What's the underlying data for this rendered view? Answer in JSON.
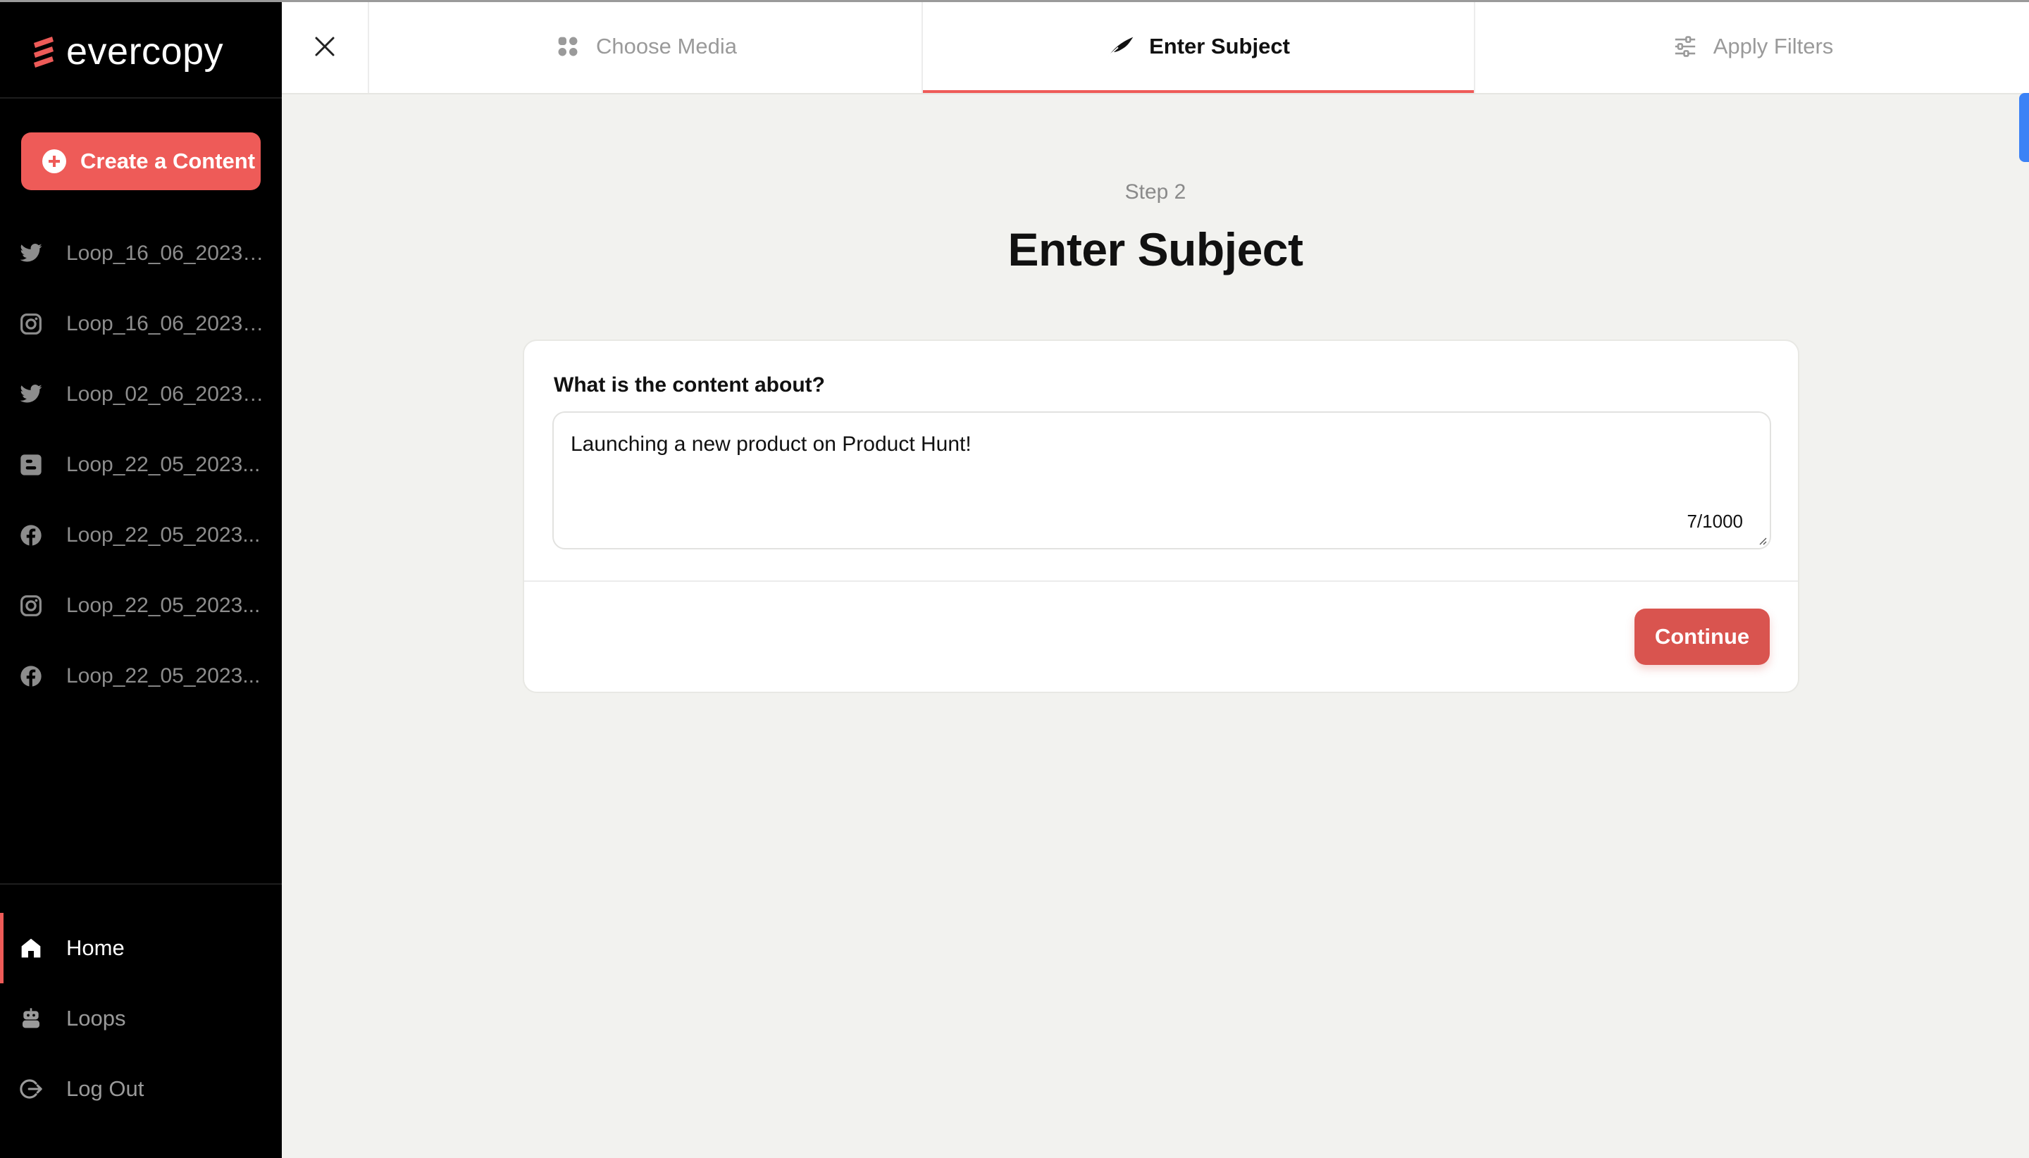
{
  "brand": {
    "name": "evercopy",
    "accent": "#ee5b58"
  },
  "sidebar": {
    "create_button": "Create a Content",
    "loops": [
      {
        "icon": "twitter-icon",
        "label": "Loop_16_06_2023_..."
      },
      {
        "icon": "instagram-icon",
        "label": "Loop_16_06_2023_1..."
      },
      {
        "icon": "twitter-icon",
        "label": "Loop_02_06_2023_..."
      },
      {
        "icon": "blogger-icon",
        "label": "Loop_22_05_2023..."
      },
      {
        "icon": "facebook-icon",
        "label": "Loop_22_05_2023..."
      },
      {
        "icon": "instagram-icon",
        "label": "Loop_22_05_2023..."
      },
      {
        "icon": "facebook-icon",
        "label": "Loop_22_05_2023..."
      }
    ],
    "nav": [
      {
        "icon": "home-icon",
        "label": "Home",
        "active": true
      },
      {
        "icon": "robot-icon",
        "label": "Loops",
        "active": false
      },
      {
        "icon": "logout-icon",
        "label": "Log Out",
        "active": false
      }
    ]
  },
  "tabs": [
    {
      "icon": "grid-icon",
      "label": "Choose Media",
      "active": false
    },
    {
      "icon": "feather-icon",
      "label": "Enter Subject",
      "active": true
    },
    {
      "icon": "sliders-icon",
      "label": "Apply Filters",
      "active": false
    }
  ],
  "main": {
    "step": "Step 2",
    "title": "Enter Subject",
    "form": {
      "label": "What is the content about?",
      "value": "Launching a new product on Product Hunt!",
      "counter": "7/1000",
      "continue": "Continue"
    }
  }
}
